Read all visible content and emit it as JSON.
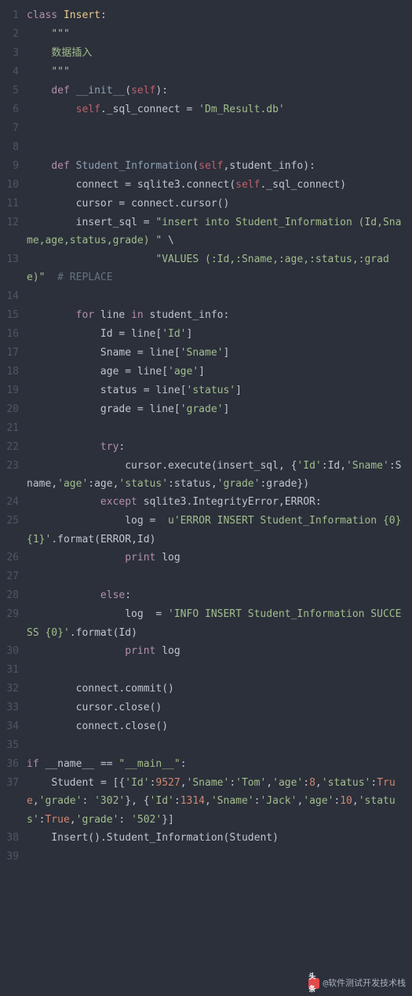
{
  "watermark": {
    "icon_text": "头条",
    "label": "@软件测试开发技术栈"
  },
  "lines": [
    {
      "n": "1",
      "tokens": [
        [
          "keyword",
          "class"
        ],
        [
          "ident",
          " "
        ],
        [
          "classname",
          "Insert"
        ],
        [
          "paren",
          ":"
        ]
      ]
    },
    {
      "n": "2",
      "tokens": [
        [
          "ident",
          "    "
        ],
        [
          "string",
          "\"\"\""
        ]
      ]
    },
    {
      "n": "3",
      "tokens": [
        [
          "ident",
          "    "
        ],
        [
          "string",
          "数据插入"
        ]
      ]
    },
    {
      "n": "4",
      "tokens": [
        [
          "ident",
          "    "
        ],
        [
          "string",
          "\"\"\""
        ]
      ]
    },
    {
      "n": "5",
      "tokens": [
        [
          "ident",
          "    "
        ],
        [
          "keyword",
          "def"
        ],
        [
          "ident",
          " "
        ],
        [
          "def",
          "__init__"
        ],
        [
          "paren",
          "("
        ],
        [
          "self",
          "self"
        ],
        [
          "paren",
          "):"
        ]
      ]
    },
    {
      "n": "6",
      "tokens": [
        [
          "ident",
          "        "
        ],
        [
          "self",
          "self"
        ],
        [
          "dot",
          "."
        ],
        [
          "ident",
          "_sql_connect "
        ],
        [
          "op",
          "="
        ],
        [
          "ident",
          " "
        ],
        [
          "string",
          "'Dm_Result.db'"
        ]
      ]
    },
    {
      "n": "7",
      "tokens": [
        [
          "ident",
          ""
        ]
      ]
    },
    {
      "n": "8",
      "tokens": [
        [
          "ident",
          ""
        ]
      ]
    },
    {
      "n": "9",
      "tokens": [
        [
          "ident",
          "    "
        ],
        [
          "keyword",
          "def"
        ],
        [
          "ident",
          " "
        ],
        [
          "def",
          "Student_Information"
        ],
        [
          "paren",
          "("
        ],
        [
          "self",
          "self"
        ],
        [
          "paren",
          ","
        ],
        [
          "ident",
          "student_info"
        ],
        [
          "paren",
          "):"
        ]
      ]
    },
    {
      "n": "10",
      "tokens": [
        [
          "ident",
          "        connect "
        ],
        [
          "op",
          "="
        ],
        [
          "ident",
          " sqlite3"
        ],
        [
          "dot",
          "."
        ],
        [
          "ident",
          "connect"
        ],
        [
          "paren",
          "("
        ],
        [
          "self",
          "self"
        ],
        [
          "dot",
          "."
        ],
        [
          "ident",
          "_sql_connect"
        ],
        [
          "paren",
          ")"
        ]
      ]
    },
    {
      "n": "11",
      "tokens": [
        [
          "ident",
          "        cursor "
        ],
        [
          "op",
          "="
        ],
        [
          "ident",
          " connect"
        ],
        [
          "dot",
          "."
        ],
        [
          "ident",
          "cursor"
        ],
        [
          "paren",
          "()"
        ]
      ]
    },
    {
      "n": "12",
      "tokens": [
        [
          "ident",
          "        insert_sql "
        ],
        [
          "op",
          "="
        ],
        [
          "ident",
          " "
        ],
        [
          "string",
          "\"insert into Student_Information (Id,Sname,age,status,grade) \""
        ],
        [
          "ident",
          " "
        ],
        [
          "op",
          "\\"
        ]
      ]
    },
    {
      "n": "13",
      "tokens": [
        [
          "ident",
          "                     "
        ],
        [
          "string",
          "\"VALUES (:Id,:Sname,:age,:status,:grade)\""
        ],
        [
          "ident",
          "  "
        ],
        [
          "comment",
          "# REPLACE"
        ]
      ]
    },
    {
      "n": "14",
      "tokens": [
        [
          "ident",
          ""
        ]
      ]
    },
    {
      "n": "15",
      "tokens": [
        [
          "ident",
          "        "
        ],
        [
          "keyword",
          "for"
        ],
        [
          "ident",
          " line "
        ],
        [
          "keyword",
          "in"
        ],
        [
          "ident",
          " student_info"
        ],
        [
          "paren",
          ":"
        ]
      ]
    },
    {
      "n": "16",
      "tokens": [
        [
          "ident",
          "            Id "
        ],
        [
          "op",
          "="
        ],
        [
          "ident",
          " line"
        ],
        [
          "paren",
          "["
        ],
        [
          "string",
          "'Id'"
        ],
        [
          "paren",
          "]"
        ]
      ]
    },
    {
      "n": "17",
      "tokens": [
        [
          "ident",
          "            Sname "
        ],
        [
          "op",
          "="
        ],
        [
          "ident",
          " line"
        ],
        [
          "paren",
          "["
        ],
        [
          "string",
          "'Sname'"
        ],
        [
          "paren",
          "]"
        ]
      ]
    },
    {
      "n": "18",
      "tokens": [
        [
          "ident",
          "            age "
        ],
        [
          "op",
          "="
        ],
        [
          "ident",
          " line"
        ],
        [
          "paren",
          "["
        ],
        [
          "string",
          "'age'"
        ],
        [
          "paren",
          "]"
        ]
      ]
    },
    {
      "n": "19",
      "tokens": [
        [
          "ident",
          "            status "
        ],
        [
          "op",
          "="
        ],
        [
          "ident",
          " line"
        ],
        [
          "paren",
          "["
        ],
        [
          "string",
          "'status'"
        ],
        [
          "paren",
          "]"
        ]
      ]
    },
    {
      "n": "20",
      "tokens": [
        [
          "ident",
          "            grade "
        ],
        [
          "op",
          "="
        ],
        [
          "ident",
          " line"
        ],
        [
          "paren",
          "["
        ],
        [
          "string",
          "'grade'"
        ],
        [
          "paren",
          "]"
        ]
      ]
    },
    {
      "n": "21",
      "tokens": [
        [
          "ident",
          ""
        ]
      ]
    },
    {
      "n": "22",
      "tokens": [
        [
          "ident",
          "            "
        ],
        [
          "keyword",
          "try"
        ],
        [
          "paren",
          ":"
        ]
      ]
    },
    {
      "n": "23",
      "tokens": [
        [
          "ident",
          "                cursor"
        ],
        [
          "dot",
          "."
        ],
        [
          "ident",
          "execute"
        ],
        [
          "paren",
          "("
        ],
        [
          "ident",
          "insert_sql"
        ],
        [
          "paren",
          ","
        ],
        [
          "ident",
          " "
        ],
        [
          "paren",
          "{"
        ],
        [
          "string",
          "'Id'"
        ],
        [
          "paren",
          ":"
        ],
        [
          "ident",
          "Id"
        ],
        [
          "paren",
          ","
        ],
        [
          "string",
          "'Sname'"
        ],
        [
          "paren",
          ":"
        ],
        [
          "ident",
          "Sname"
        ],
        [
          "paren",
          ","
        ],
        [
          "string",
          "'age'"
        ],
        [
          "paren",
          ":"
        ],
        [
          "ident",
          "age"
        ],
        [
          "paren",
          ","
        ],
        [
          "string",
          "'status'"
        ],
        [
          "paren",
          ":"
        ],
        [
          "ident",
          "status"
        ],
        [
          "paren",
          ","
        ],
        [
          "string",
          "'grade'"
        ],
        [
          "paren",
          ":"
        ],
        [
          "ident",
          "grade"
        ],
        [
          "paren",
          "})"
        ]
      ]
    },
    {
      "n": "24",
      "tokens": [
        [
          "ident",
          "            "
        ],
        [
          "keyword",
          "except"
        ],
        [
          "ident",
          " sqlite3"
        ],
        [
          "dot",
          "."
        ],
        [
          "ident",
          "IntegrityError"
        ],
        [
          "paren",
          ","
        ],
        [
          "ident",
          "ERROR"
        ],
        [
          "paren",
          ":"
        ]
      ]
    },
    {
      "n": "25",
      "tokens": [
        [
          "ident",
          "                log "
        ],
        [
          "op",
          "="
        ],
        [
          "ident",
          "  "
        ],
        [
          "string",
          "u'ERROR INSERT Student_Information {0} {1}'"
        ],
        [
          "dot",
          "."
        ],
        [
          "ident",
          "format"
        ],
        [
          "paren",
          "("
        ],
        [
          "ident",
          "ERROR"
        ],
        [
          "paren",
          ","
        ],
        [
          "ident",
          "Id"
        ],
        [
          "paren",
          ")"
        ]
      ]
    },
    {
      "n": "26",
      "tokens": [
        [
          "ident",
          "                "
        ],
        [
          "keyword",
          "print"
        ],
        [
          "ident",
          " log"
        ]
      ]
    },
    {
      "n": "27",
      "tokens": [
        [
          "ident",
          ""
        ]
      ]
    },
    {
      "n": "28",
      "tokens": [
        [
          "ident",
          "            "
        ],
        [
          "keyword",
          "else"
        ],
        [
          "paren",
          ":"
        ]
      ]
    },
    {
      "n": "29",
      "tokens": [
        [
          "ident",
          "                log  "
        ],
        [
          "op",
          "="
        ],
        [
          "ident",
          " "
        ],
        [
          "string",
          "'INFO INSERT Student_Information SUCCESS {0}'"
        ],
        [
          "dot",
          "."
        ],
        [
          "ident",
          "format"
        ],
        [
          "paren",
          "("
        ],
        [
          "ident",
          "Id"
        ],
        [
          "paren",
          ")"
        ]
      ]
    },
    {
      "n": "30",
      "tokens": [
        [
          "ident",
          "                "
        ],
        [
          "keyword",
          "print"
        ],
        [
          "ident",
          " log"
        ]
      ]
    },
    {
      "n": "31",
      "tokens": [
        [
          "ident",
          ""
        ]
      ]
    },
    {
      "n": "32",
      "tokens": [
        [
          "ident",
          "        connect"
        ],
        [
          "dot",
          "."
        ],
        [
          "ident",
          "commit"
        ],
        [
          "paren",
          "()"
        ]
      ]
    },
    {
      "n": "33",
      "tokens": [
        [
          "ident",
          "        cursor"
        ],
        [
          "dot",
          "."
        ],
        [
          "ident",
          "close"
        ],
        [
          "paren",
          "()"
        ]
      ]
    },
    {
      "n": "34",
      "tokens": [
        [
          "ident",
          "        connect"
        ],
        [
          "dot",
          "."
        ],
        [
          "ident",
          "close"
        ],
        [
          "paren",
          "()"
        ]
      ]
    },
    {
      "n": "35",
      "tokens": [
        [
          "ident",
          ""
        ]
      ]
    },
    {
      "n": "36",
      "tokens": [
        [
          "keyword",
          "if"
        ],
        [
          "ident",
          " __name__ "
        ],
        [
          "op",
          "=="
        ],
        [
          "ident",
          " "
        ],
        [
          "string",
          "\"__main__\""
        ],
        [
          "paren",
          ":"
        ]
      ]
    },
    {
      "n": "37",
      "tokens": [
        [
          "ident",
          "    Student "
        ],
        [
          "op",
          "="
        ],
        [
          "ident",
          " "
        ],
        [
          "paren",
          "[{"
        ],
        [
          "string",
          "'Id'"
        ],
        [
          "paren",
          ":"
        ],
        [
          "num",
          "9527"
        ],
        [
          "paren",
          ","
        ],
        [
          "string",
          "'Sname'"
        ],
        [
          "paren",
          ":"
        ],
        [
          "string",
          "'Tom'"
        ],
        [
          "paren",
          ","
        ],
        [
          "string",
          "'age'"
        ],
        [
          "paren",
          ":"
        ],
        [
          "num",
          "8"
        ],
        [
          "paren",
          ","
        ],
        [
          "string",
          "'status'"
        ],
        [
          "paren",
          ":"
        ],
        [
          "const",
          "True"
        ],
        [
          "paren",
          ","
        ],
        [
          "string",
          "'grade'"
        ],
        [
          "paren",
          ":"
        ],
        [
          "ident",
          " "
        ],
        [
          "string",
          "'302'"
        ],
        [
          "paren",
          "},"
        ],
        [
          "ident",
          " "
        ],
        [
          "paren",
          "{"
        ],
        [
          "string",
          "'Id'"
        ],
        [
          "paren",
          ":"
        ],
        [
          "num",
          "1314"
        ],
        [
          "paren",
          ","
        ],
        [
          "string",
          "'Sname'"
        ],
        [
          "paren",
          ":"
        ],
        [
          "string",
          "'Jack'"
        ],
        [
          "paren",
          ","
        ],
        [
          "string",
          "'age'"
        ],
        [
          "paren",
          ":"
        ],
        [
          "num",
          "10"
        ],
        [
          "paren",
          ","
        ],
        [
          "string",
          "'status'"
        ],
        [
          "paren",
          ":"
        ],
        [
          "const",
          "True"
        ],
        [
          "paren",
          ","
        ],
        [
          "string",
          "'grade'"
        ],
        [
          "paren",
          ":"
        ],
        [
          "ident",
          " "
        ],
        [
          "string",
          "'502'"
        ],
        [
          "paren",
          "}]"
        ]
      ]
    },
    {
      "n": "38",
      "tokens": [
        [
          "ident",
          "    Insert"
        ],
        [
          "paren",
          "()"
        ],
        [
          "dot",
          "."
        ],
        [
          "ident",
          "Student_Information"
        ],
        [
          "paren",
          "("
        ],
        [
          "ident",
          "Student"
        ],
        [
          "paren",
          ")"
        ]
      ]
    },
    {
      "n": "39",
      "tokens": [
        [
          "ident",
          ""
        ]
      ]
    }
  ]
}
